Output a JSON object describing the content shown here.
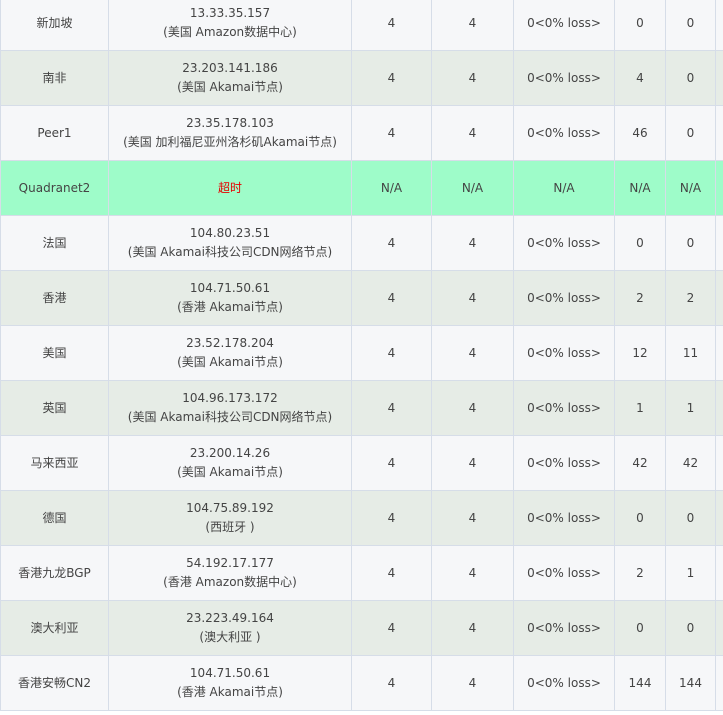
{
  "rows": [
    {
      "node": "新加坡",
      "ip": "13.33.35.157",
      "location": "(美国 Amazon数据中心)",
      "sent": "4",
      "received": "4",
      "loss": "0<0% loss>",
      "c7": "0",
      "c8": "0",
      "status": "ok"
    },
    {
      "node": "南非",
      "ip": "23.203.141.186",
      "location": "(美国 Akamai节点)",
      "sent": "4",
      "received": "4",
      "loss": "0<0% loss>",
      "c7": "4",
      "c8": "0",
      "status": "ok"
    },
    {
      "node": "Peer1",
      "ip": "23.35.178.103",
      "location": "(美国 加利福尼亚州洛杉矶Akamai节点)",
      "sent": "4",
      "received": "4",
      "loss": "0<0% loss>",
      "c7": "46",
      "c8": "0",
      "status": "ok"
    },
    {
      "node": "Quadranet2",
      "ip": "超时",
      "location": "",
      "sent": "N/A",
      "received": "N/A",
      "loss": "N/A",
      "c7": "N/A",
      "c8": "N/A",
      "status": "timeout"
    },
    {
      "node": "法国",
      "ip": "104.80.23.51",
      "location": "(美国 Akamai科技公司CDN网络节点)",
      "sent": "4",
      "received": "4",
      "loss": "0<0% loss>",
      "c7": "0",
      "c8": "0",
      "status": "ok"
    },
    {
      "node": "香港",
      "ip": "104.71.50.61",
      "location": "(香港 Akamai节点)",
      "sent": "4",
      "received": "4",
      "loss": "0<0% loss>",
      "c7": "2",
      "c8": "2",
      "status": "ok"
    },
    {
      "node": "美国",
      "ip": "23.52.178.204",
      "location": "(美国 Akamai节点)",
      "sent": "4",
      "received": "4",
      "loss": "0<0% loss>",
      "c7": "12",
      "c8": "11",
      "status": "ok"
    },
    {
      "node": "英国",
      "ip": "104.96.173.172",
      "location": "(美国 Akamai科技公司CDN网络节点)",
      "sent": "4",
      "received": "4",
      "loss": "0<0% loss>",
      "c7": "1",
      "c8": "1",
      "status": "ok"
    },
    {
      "node": "马来西亚",
      "ip": "23.200.14.26",
      "location": "(美国 Akamai节点)",
      "sent": "4",
      "received": "4",
      "loss": "0<0% loss>",
      "c7": "42",
      "c8": "42",
      "status": "ok"
    },
    {
      "node": "德国",
      "ip": "104.75.89.192",
      "location": "(西班牙 )",
      "sent": "4",
      "received": "4",
      "loss": "0<0% loss>",
      "c7": "0",
      "c8": "0",
      "status": "ok"
    },
    {
      "node": "香港九龙BGP",
      "ip": "54.192.17.177",
      "location": "(香港 Amazon数据中心)",
      "sent": "4",
      "received": "4",
      "loss": "0<0% loss>",
      "c7": "2",
      "c8": "1",
      "status": "ok"
    },
    {
      "node": "澳大利亚",
      "ip": "23.223.49.164",
      "location": "(澳大利亚 )",
      "sent": "4",
      "received": "4",
      "loss": "0<0% loss>",
      "c7": "0",
      "c8": "0",
      "status": "ok"
    },
    {
      "node": "香港安畅CN2",
      "ip": "104.71.50.61",
      "location": "(香港 Akamai节点)",
      "sent": "4",
      "received": "4",
      "loss": "0<0% loss>",
      "c7": "144",
      "c8": "144",
      "status": "ok"
    }
  ],
  "colors": {
    "row_odd": "#f6f7f9",
    "row_even": "#e6ece6",
    "row_timeout": "#9efcc9",
    "timeout_text": "#e60000",
    "border": "#d6dde8"
  }
}
